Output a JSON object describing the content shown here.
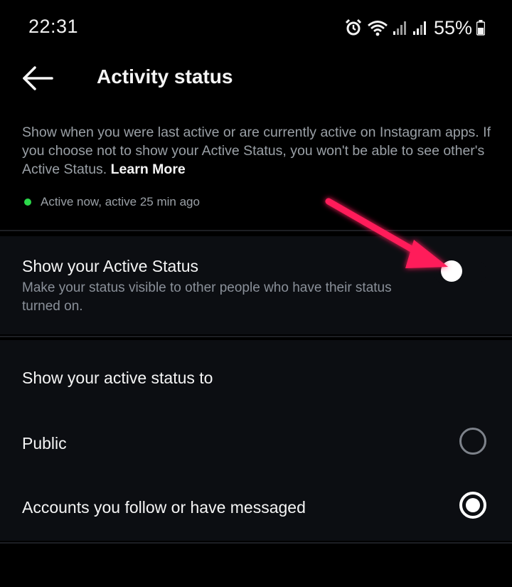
{
  "status_bar": {
    "time": "22:31",
    "battery": "55%",
    "icons": [
      "alarm-icon",
      "wifi-icon",
      "signal-icon",
      "signal-icon",
      "battery-icon"
    ]
  },
  "header": {
    "title": "Activity status",
    "back_icon": "arrow-left-icon"
  },
  "description": {
    "text": "Show when you were last active or are currently active on Instagram apps. If you choose not to show your Active Status, you won't be able to see other's Active Status.",
    "link": "Learn More"
  },
  "preview": {
    "text": "Active now, active 25 min ago",
    "dot_color": "#2bd84a"
  },
  "active_status_toggle": {
    "title": "Show your Active Status",
    "subtitle": "Make your status visible to other people who have their status turned on.",
    "enabled": false
  },
  "audience": {
    "title": "Show your active status to",
    "options": [
      {
        "label": "Public",
        "selected": false
      },
      {
        "label": "Accounts you follow or have messaged",
        "selected": true
      }
    ]
  },
  "annotation": {
    "arrow_color": "#ff1f5a"
  }
}
